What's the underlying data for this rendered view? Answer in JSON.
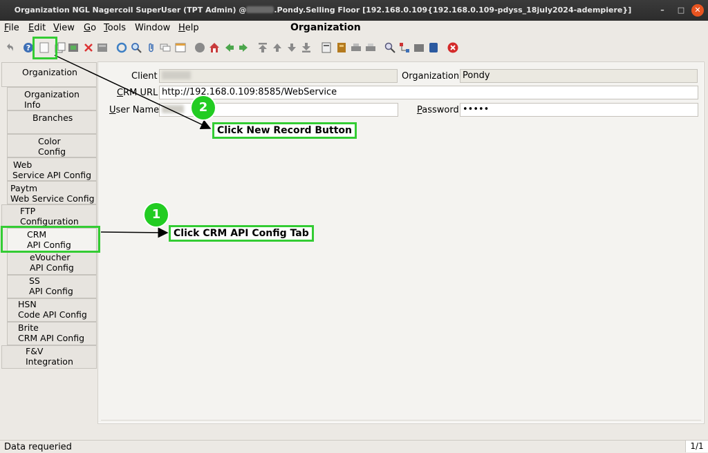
{
  "window": {
    "title_prefix": "Organization  NGL  Nagercoil  SuperUser (TPT Admin) @",
    "title_suffix": ".Pondy.Selling Floor [192.168.0.109{192.168.0.109-pdyss_18july2024-adempiere}]",
    "minimize": "–",
    "maximize": "□",
    "close": "✕"
  },
  "menu": {
    "items": [
      {
        "label": "File",
        "mnemonic": "F",
        "rest": "ile"
      },
      {
        "label": "Edit",
        "mnemonic": "E",
        "rest": "dit"
      },
      {
        "label": "View",
        "mnemonic": "V",
        "rest": "iew"
      },
      {
        "label": "Go",
        "mnemonic": "G",
        "rest": "o"
      },
      {
        "label": "Tools",
        "mnemonic": "T",
        "rest": "ools"
      },
      {
        "label": "Window",
        "mnemonic": "",
        "rest": "Window"
      },
      {
        "label": "Help",
        "mnemonic": "H",
        "rest": "elp"
      }
    ],
    "window_heading": "Organization"
  },
  "toolbar": {
    "icons": [
      "undo-icon",
      "help-icon",
      "new-record-icon",
      "copy-record-icon",
      "save-icon",
      "delete-icon",
      "refresh-icon",
      "refresh2-icon",
      "find-icon",
      "attachment-icon",
      "chat-icon",
      "grid-toggle-icon",
      "history-icon",
      "home-icon",
      "back-icon",
      "forward-icon",
      "first-record-icon",
      "previous-record-icon",
      "next-record-icon",
      "last-record-icon",
      "report-icon",
      "archive-icon",
      "print-preview-icon",
      "print-icon",
      "zoom-across-icon",
      "workflow-icon",
      "request-icon",
      "product-info-icon",
      "exit-icon"
    ]
  },
  "tabs": [
    {
      "name": "tab-organization",
      "lines": [
        "Organization"
      ]
    },
    {
      "name": "tab-organization-info",
      "lines": [
        "Organization",
        "Info"
      ]
    },
    {
      "name": "tab-branches",
      "lines": [
        "Branches"
      ]
    },
    {
      "name": "tab-color-config",
      "lines": [
        "Color",
        "Config"
      ]
    },
    {
      "name": "tab-web-service-api-config",
      "lines": [
        "Web",
        "Service API Config"
      ]
    },
    {
      "name": "tab-paytm-web-service-config",
      "lines": [
        "Paytm",
        "Web Service Config"
      ]
    },
    {
      "name": "tab-ftp-configuration",
      "lines": [
        "FTP",
        "Configuration"
      ]
    },
    {
      "name": "tab-crm-api-config",
      "lines": [
        "CRM",
        "API Config"
      ]
    },
    {
      "name": "tab-evoucher-api-config",
      "lines": [
        "eVoucher",
        "API Config"
      ]
    },
    {
      "name": "tab-ss-api-config",
      "lines": [
        "SS",
        "API Config"
      ]
    },
    {
      "name": "tab-hsn-code-api-config",
      "lines": [
        "HSN",
        "Code API Config"
      ]
    },
    {
      "name": "tab-brite-crm-api-config",
      "lines": [
        "Brite",
        "CRM API Config"
      ]
    },
    {
      "name": "tab-fv-integration",
      "lines": [
        "F&V",
        "Integration"
      ]
    }
  ],
  "form": {
    "client_label": "Client",
    "organization_label": "Organization",
    "organization_value": "Pondy",
    "crm_url_label_mn": "C",
    "crm_url_label_rest": "RM URL",
    "crm_url_value": "http://192.168.0.109:8585/WebService",
    "user_name_label_mn": "U",
    "user_name_label_rest": "ser Name",
    "password_label_mn": "P",
    "password_label_rest": "assword",
    "password_value": "•••••"
  },
  "annotations": {
    "step1_number": "1",
    "step1_text": "Click CRM API Config Tab",
    "step2_number": "2",
    "step2_text": "Click New Record Button",
    "highlight_color": "#33cc33"
  },
  "status": {
    "message": "Data requeried",
    "record_count": "1/1"
  }
}
